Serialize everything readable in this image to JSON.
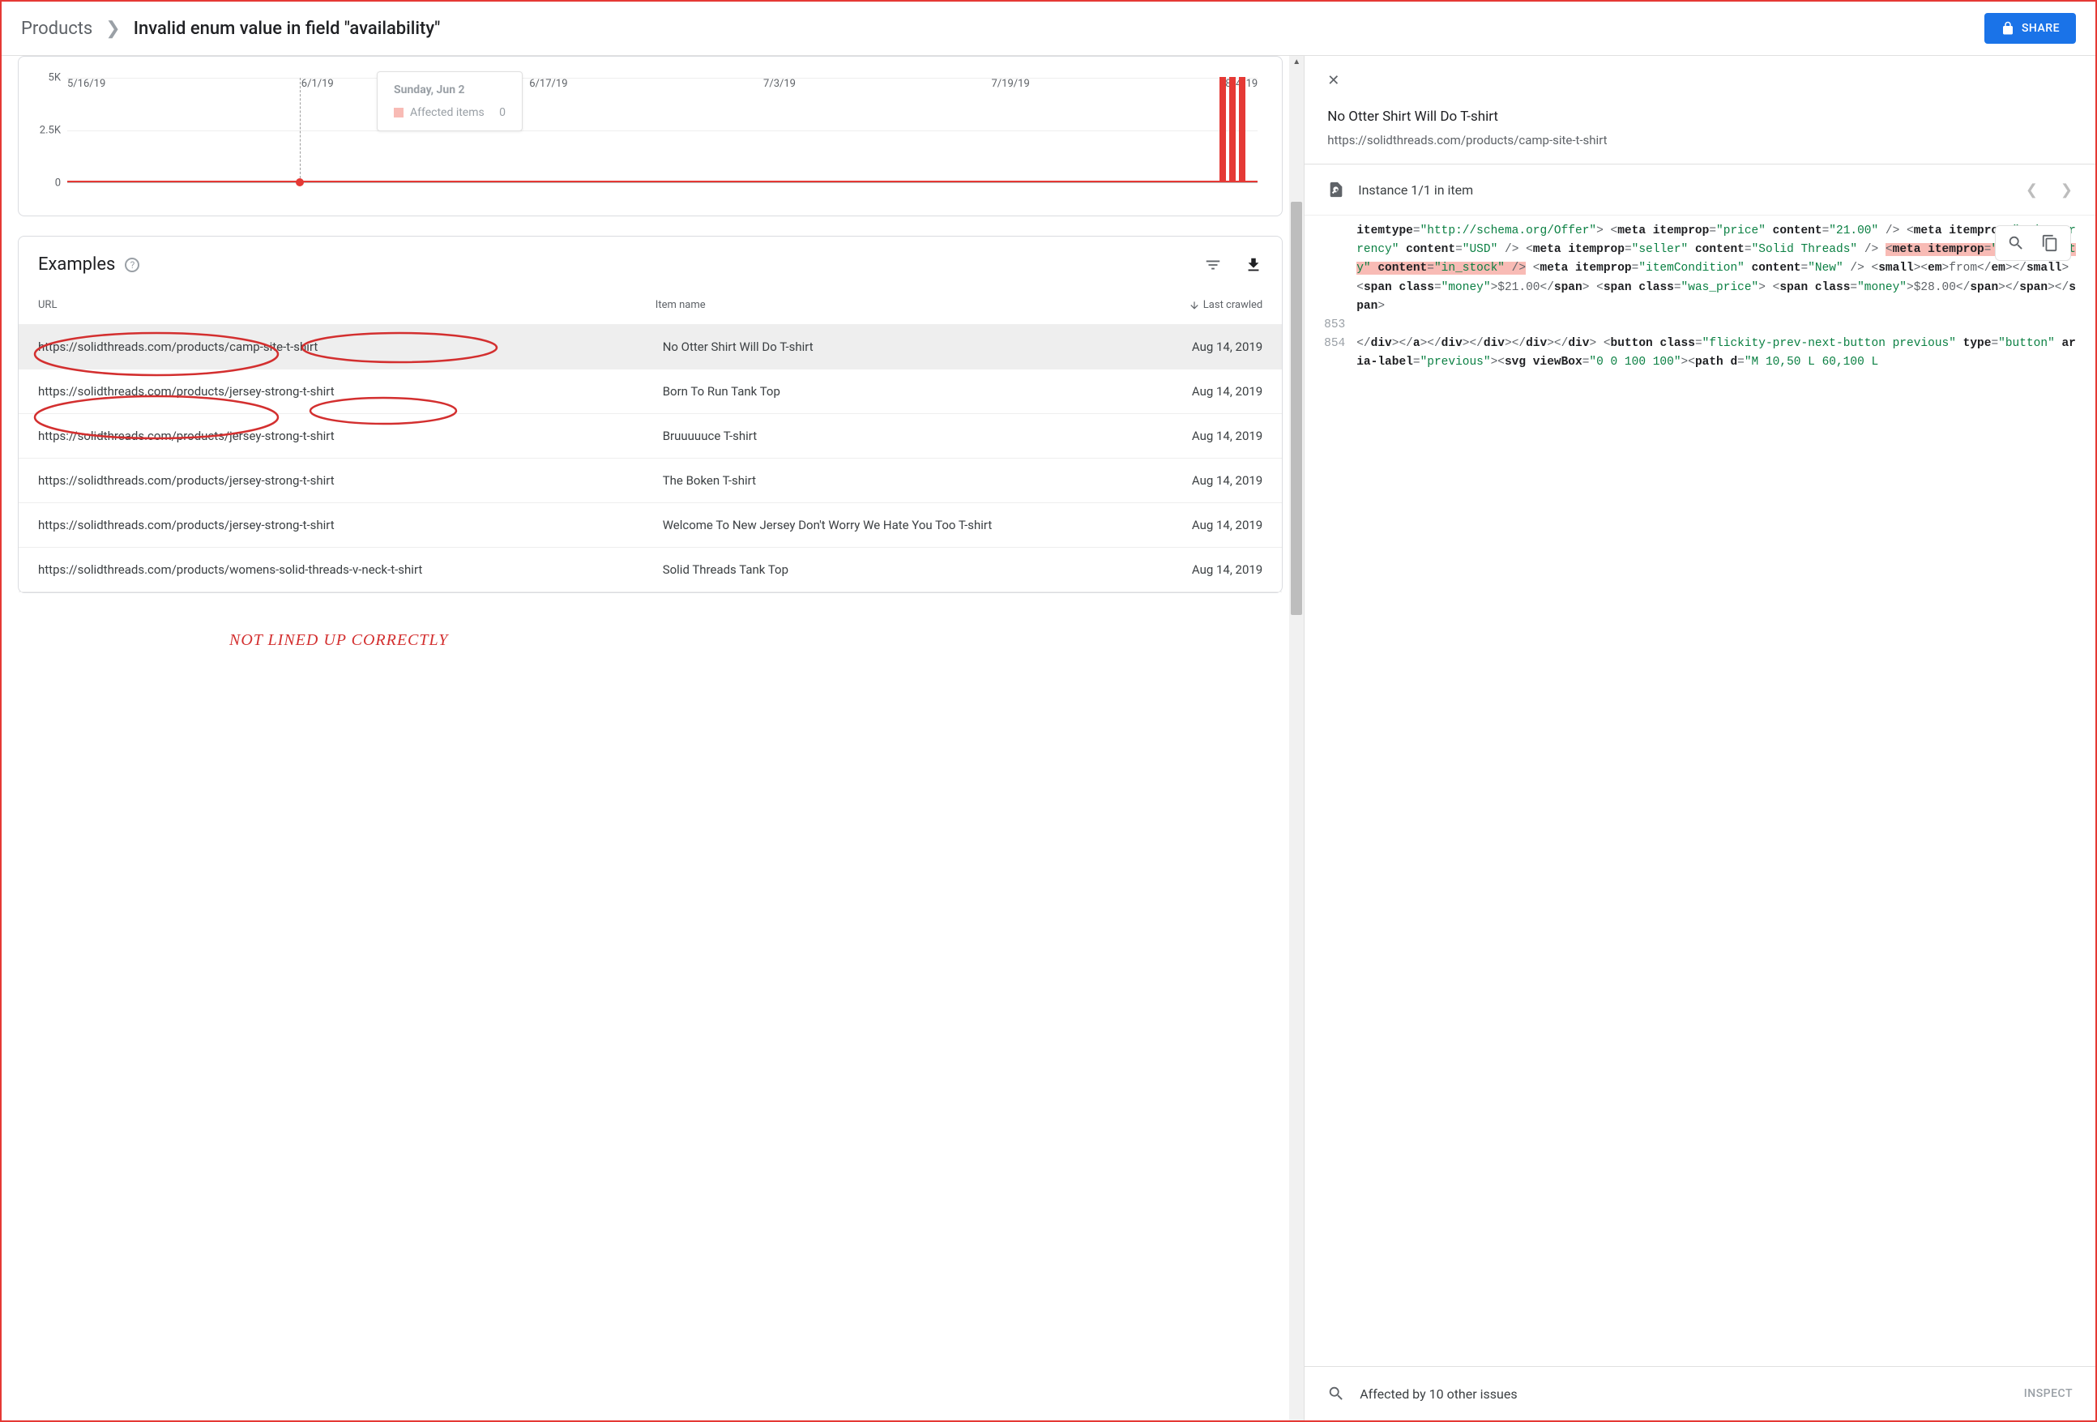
{
  "header": {
    "root": "Products",
    "current": "Invalid enum value in field \"availability\"",
    "share": "SHARE"
  },
  "chart_data": {
    "type": "bar",
    "yticks": [
      "5K",
      "2.5K",
      "0"
    ],
    "categories": [
      "5/16/19",
      "6/1/19",
      "6/17/19",
      "7/3/19",
      "7/19/19",
      "8/4/19"
    ],
    "tooltip_date": "Sunday, Jun 2",
    "tooltip_series": "Affected items",
    "tooltip_value": "0",
    "title": "",
    "xlabel": "",
    "ylabel": "",
    "series": [
      {
        "name": "Affected items",
        "values_approx": "0 across range, spike ~5K near mid-August"
      }
    ]
  },
  "examples": {
    "title": "Examples",
    "cols": {
      "url": "URL",
      "item": "Item name",
      "date": "Last crawled"
    },
    "rows": [
      {
        "url": "https://solidthreads.com/products/camp-site-t-shirt",
        "item": "No Otter Shirt Will Do T-shirt",
        "date": "Aug 14, 2019",
        "selected": true
      },
      {
        "url": "https://solidthreads.com/products/jersey-strong-t-shirt",
        "item": "Born To Run Tank Top",
        "date": "Aug 14, 2019"
      },
      {
        "url": "https://solidthreads.com/products/jersey-strong-t-shirt",
        "item": "Bruuuuuce T-shirt",
        "date": "Aug 14, 2019"
      },
      {
        "url": "https://solidthreads.com/products/jersey-strong-t-shirt",
        "item": "The Boken T-shirt",
        "date": "Aug 14, 2019"
      },
      {
        "url": "https://solidthreads.com/products/jersey-strong-t-shirt",
        "item": "Welcome To New Jersey Don't Worry We Hate You Too T-shirt",
        "date": "Aug 14, 2019"
      },
      {
        "url": "https://solidthreads.com/products/womens-solid-threads-v-neck-t-shirt",
        "item": "Solid Threads Tank Top",
        "date": "Aug 14, 2019"
      }
    ]
  },
  "annotation": "NOT LINED UP CORRECTLY",
  "detail": {
    "title": "No Otter Shirt Will Do T-shirt",
    "url": "https://solidthreads.com/products/camp-site-t-shirt",
    "instance_label": "Instance 1/1 in item",
    "affected_label": "Affected by 10 other issues",
    "inspect": "INSPECT",
    "code_lines": [
      "853",
      "854"
    ]
  }
}
